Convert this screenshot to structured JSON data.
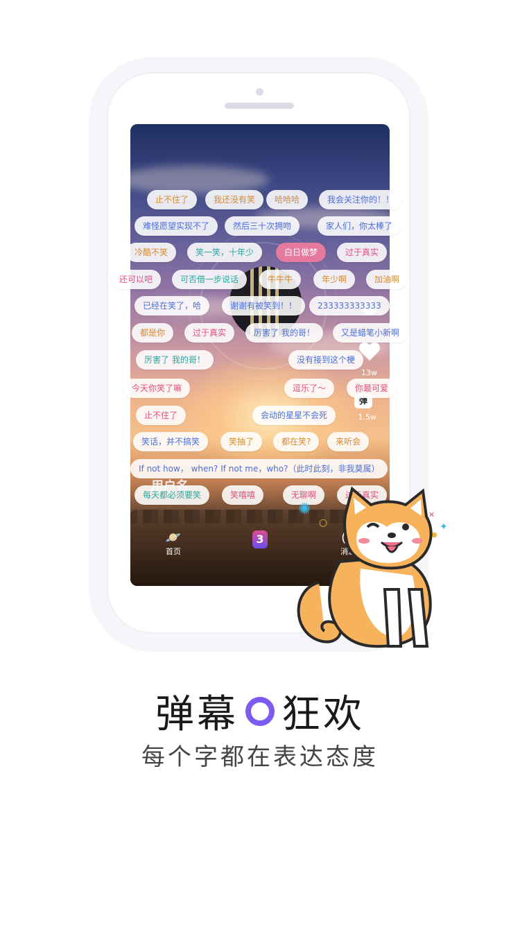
{
  "screen": {
    "like_count": "13w",
    "danmu_icon_label": "弹",
    "danmu_count": "1.5w",
    "username": "用户名",
    "nav": {
      "home": "首页",
      "message": "消息"
    }
  },
  "danmaku": [
    {
      "text": "止不住了",
      "color": "orange"
    },
    {
      "text": "我还没有笑",
      "color": "orange"
    },
    {
      "text": "哈哈哈",
      "color": "orange"
    },
    {
      "text": "我会关注你的！！",
      "color": "blue"
    },
    {
      "text": "难怪愿望实现不了",
      "color": "blue"
    },
    {
      "text": "然后三十次拥吻",
      "color": "blue"
    },
    {
      "text": "家人们，你太棒了",
      "color": "blue"
    },
    {
      "text": "冷酷不笑",
      "color": "orange"
    },
    {
      "text": "笑一笑，十年少",
      "color": "teal"
    },
    {
      "text": "白日做梦",
      "color": "highlight"
    },
    {
      "text": "过于真实",
      "color": "pink"
    },
    {
      "text": "还可以吧",
      "color": "pink"
    },
    {
      "text": "可否借一步说话",
      "color": "teal"
    },
    {
      "text": "牛牛牛",
      "color": "orange"
    },
    {
      "text": "年少啊",
      "color": "orange"
    },
    {
      "text": "加油啊",
      "color": "orange"
    },
    {
      "text": "已经在笑了，哈",
      "color": "blue"
    },
    {
      "text": "谢谢有被笑到！！",
      "color": "blue"
    },
    {
      "text": "233333333333",
      "color": "blue"
    },
    {
      "text": "都是你",
      "color": "orange"
    },
    {
      "text": "过于真实",
      "color": "pink"
    },
    {
      "text": "厉害了 我的哥！",
      "color": "blue"
    },
    {
      "text": "又是蜡笔小新啊",
      "color": "blue"
    },
    {
      "text": "厉害了 我的哥！",
      "color": "teal"
    },
    {
      "text": "没有接到这个梗",
      "color": "blue"
    },
    {
      "text": "今天你笑了嘛",
      "color": "pink"
    },
    {
      "text": "逗乐了～",
      "color": "pink"
    },
    {
      "text": "你最可爱",
      "color": "pink"
    },
    {
      "text": "止不住了",
      "color": "pink"
    },
    {
      "text": "会动的星星不会死",
      "color": "blue"
    },
    {
      "text": "笑话，并不搞笑",
      "color": "blue"
    },
    {
      "text": "笑抽了",
      "color": "orange"
    },
    {
      "text": "都在笑?",
      "color": "orange"
    },
    {
      "text": "来听会",
      "color": "orange"
    },
    {
      "text": "If not how， when?  If not me，who?（此时此刻，非我莫属）",
      "color": "blue"
    },
    {
      "text": "每天都必须要笑",
      "color": "teal"
    },
    {
      "text": "笑嘻嘻",
      "color": "pink"
    },
    {
      "text": "无聊啊",
      "color": "pink"
    },
    {
      "text": "过于真实",
      "color": "pink"
    }
  ],
  "caption": {
    "headline_left": "弹幕",
    "headline_right": "狂欢",
    "subline": "每个字都在表达态度"
  },
  "colors": {
    "orange": "#d78a2b",
    "blue": "#4b6fd8",
    "pink": "#e0507e",
    "teal": "#28a7a0",
    "highlight": "#e57a9e",
    "ring": "#7d5bf0"
  }
}
